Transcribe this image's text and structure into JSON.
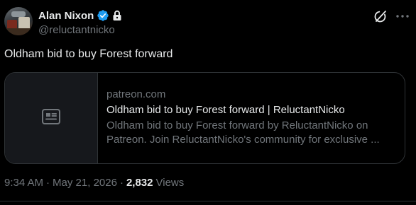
{
  "author": {
    "name": "Alan Nixon",
    "handle": "@reluctantnicko"
  },
  "post": {
    "text": "Oldham bid to buy Forest forward"
  },
  "card": {
    "domain": "patreon.com",
    "title": "Oldham bid to buy Forest forward | ReluctantNicko",
    "description": "Oldham bid to buy Forest forward by ReluctantNicko on Patreon. Join ReluctantNicko's community for exclusive ..."
  },
  "meta": {
    "time": "9:34 AM",
    "date": "May 21, 2026",
    "views_count": "2,832",
    "views_label": "Views",
    "separator": "·"
  },
  "colors": {
    "background": "#000000",
    "text_primary": "#e7e9ea",
    "text_secondary": "#71767b",
    "border": "#2f3336",
    "verified": "#1d9bf0"
  },
  "icons": {
    "verified": "verified-badge-icon",
    "lock": "lock-icon",
    "grok": "grok-icon",
    "more": "more-icon",
    "article": "article-icon"
  }
}
